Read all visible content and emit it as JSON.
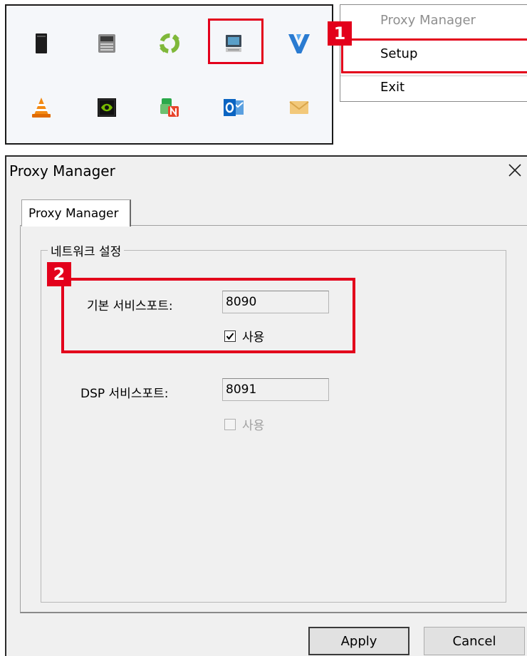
{
  "context_menu": {
    "items": [
      {
        "label": "Proxy Manager",
        "enabled": false
      },
      {
        "label": "Setup",
        "enabled": true
      },
      {
        "label": "Exit",
        "enabled": true
      }
    ]
  },
  "steps": {
    "step1": "1",
    "step2": "2"
  },
  "dialog": {
    "title": "Proxy Manager",
    "tab_label": "Proxy Manager",
    "group_title": "네트워크 설정",
    "default_port_label": "기본 서비스포트:",
    "default_port_value": "8090",
    "default_port_use_label": "사용",
    "default_port_use_checked": true,
    "dsp_port_label": "DSP 서비스포트:",
    "dsp_port_value": "8091",
    "dsp_port_use_label": "사용",
    "dsp_port_use_checked": false,
    "apply_label": "Apply",
    "cancel_label": "Cancel"
  },
  "colors": {
    "highlight": "#e3001b",
    "dialog_bg": "#f0f0f0"
  },
  "tray_icons": [
    "dark-tower-icon",
    "gray-device-icon",
    "green-recycle-icon",
    "proxy-manager-icon",
    "blue-v-icon",
    "vlc-cone-icon",
    "nvidia-icon",
    "naver-n-icon",
    "outlook-icon",
    "mail-envelope-icon"
  ]
}
